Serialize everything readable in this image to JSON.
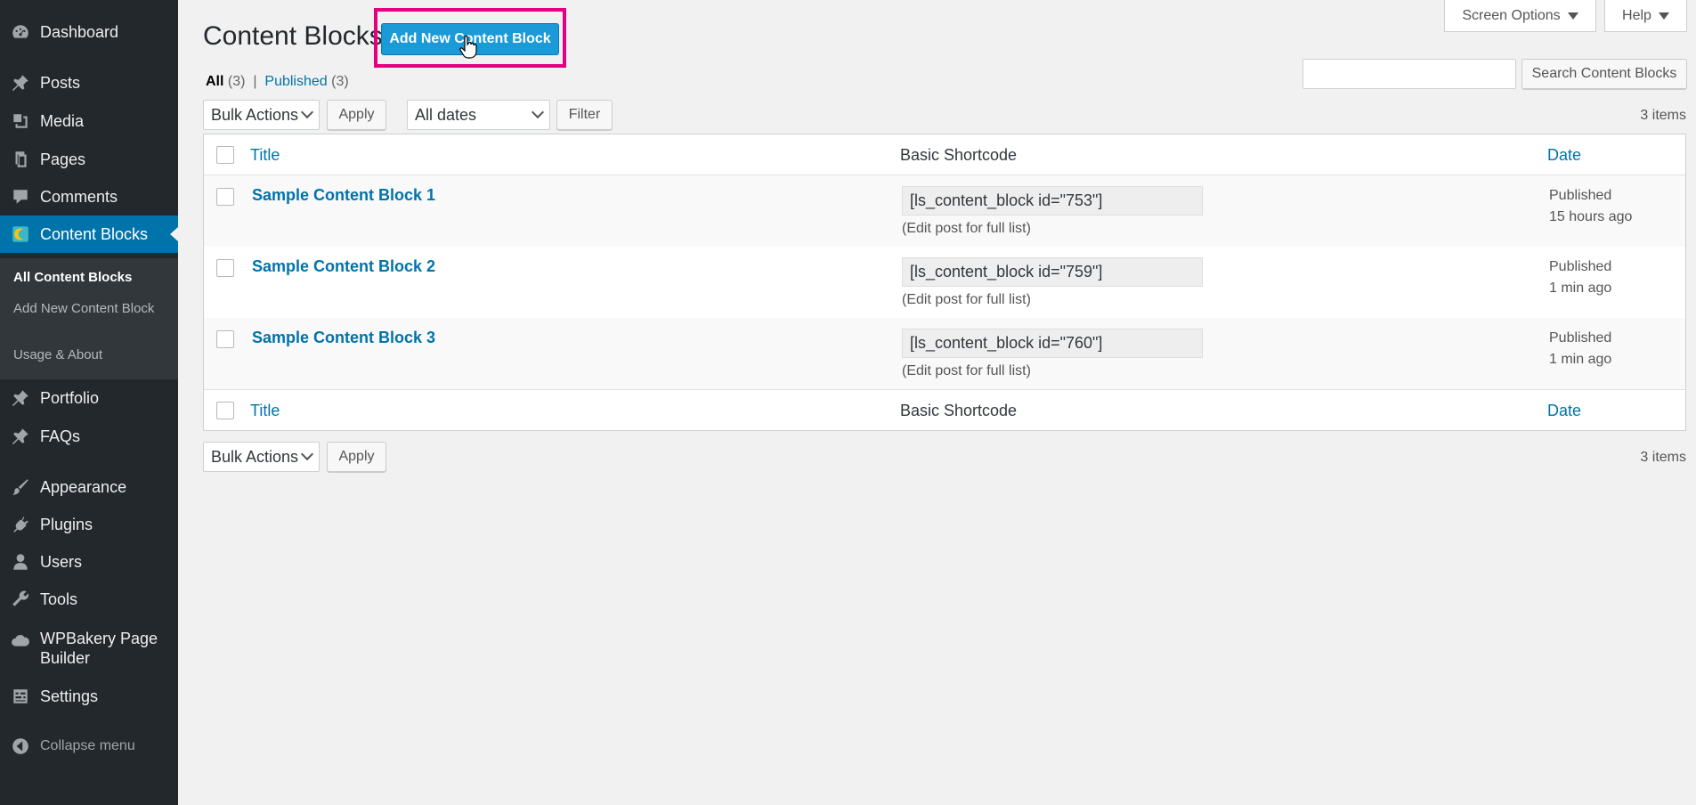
{
  "sidebar": {
    "items": [
      {
        "label": "Dashboard",
        "icon": "dashboard-icon"
      },
      {
        "label": "Posts",
        "icon": "pin-icon"
      },
      {
        "label": "Media",
        "icon": "media-icon"
      },
      {
        "label": "Pages",
        "icon": "pages-icon"
      },
      {
        "label": "Comments",
        "icon": "comment-icon"
      },
      {
        "label": "Content Blocks",
        "icon": "content-blocks-icon"
      },
      {
        "label": "Portfolio",
        "icon": "pin-icon"
      },
      {
        "label": "FAQs",
        "icon": "pin-icon"
      },
      {
        "label": "Appearance",
        "icon": "brush-icon"
      },
      {
        "label": "Plugins",
        "icon": "plug-icon"
      },
      {
        "label": "Users",
        "icon": "user-icon"
      },
      {
        "label": "Tools",
        "icon": "wrench-icon"
      },
      {
        "label": "WPBakery Page Builder",
        "icon": "cloud-icon"
      },
      {
        "label": "Settings",
        "icon": "settings-icon"
      }
    ],
    "submenu": [
      "All Content Blocks",
      "Add New Content Block",
      "Usage & About"
    ],
    "collapse": "Collapse menu"
  },
  "top": {
    "screen_options": "Screen Options",
    "help": "Help"
  },
  "header": {
    "title": "Content Blocks",
    "add_new": "Add New Content Block"
  },
  "filters": {
    "all": "All",
    "all_count": "(3)",
    "sep": "|",
    "published": "Published",
    "published_count": "(3)",
    "search_button": "Search Content Blocks",
    "bulk_actions": "Bulk Actions",
    "apply": "Apply",
    "dates": "All dates",
    "filter": "Filter",
    "items_count": "3 items"
  },
  "table": {
    "columns": {
      "title": "Title",
      "shortcode": "Basic Shortcode",
      "date": "Date"
    },
    "rows": [
      {
        "title": "Sample Content Block 1",
        "shortcode": "[ls_content_block id=\"753\"]",
        "note": "(Edit post for full list)",
        "status": "Published",
        "when": "15 hours ago"
      },
      {
        "title": "Sample Content Block 2",
        "shortcode": "[ls_content_block id=\"759\"]",
        "note": "(Edit post for full list)",
        "status": "Published",
        "when": "1 min ago"
      },
      {
        "title": "Sample Content Block 3",
        "shortcode": "[ls_content_block id=\"760\"]",
        "note": "(Edit post for full list)",
        "status": "Published",
        "when": "1 min ago"
      }
    ]
  }
}
